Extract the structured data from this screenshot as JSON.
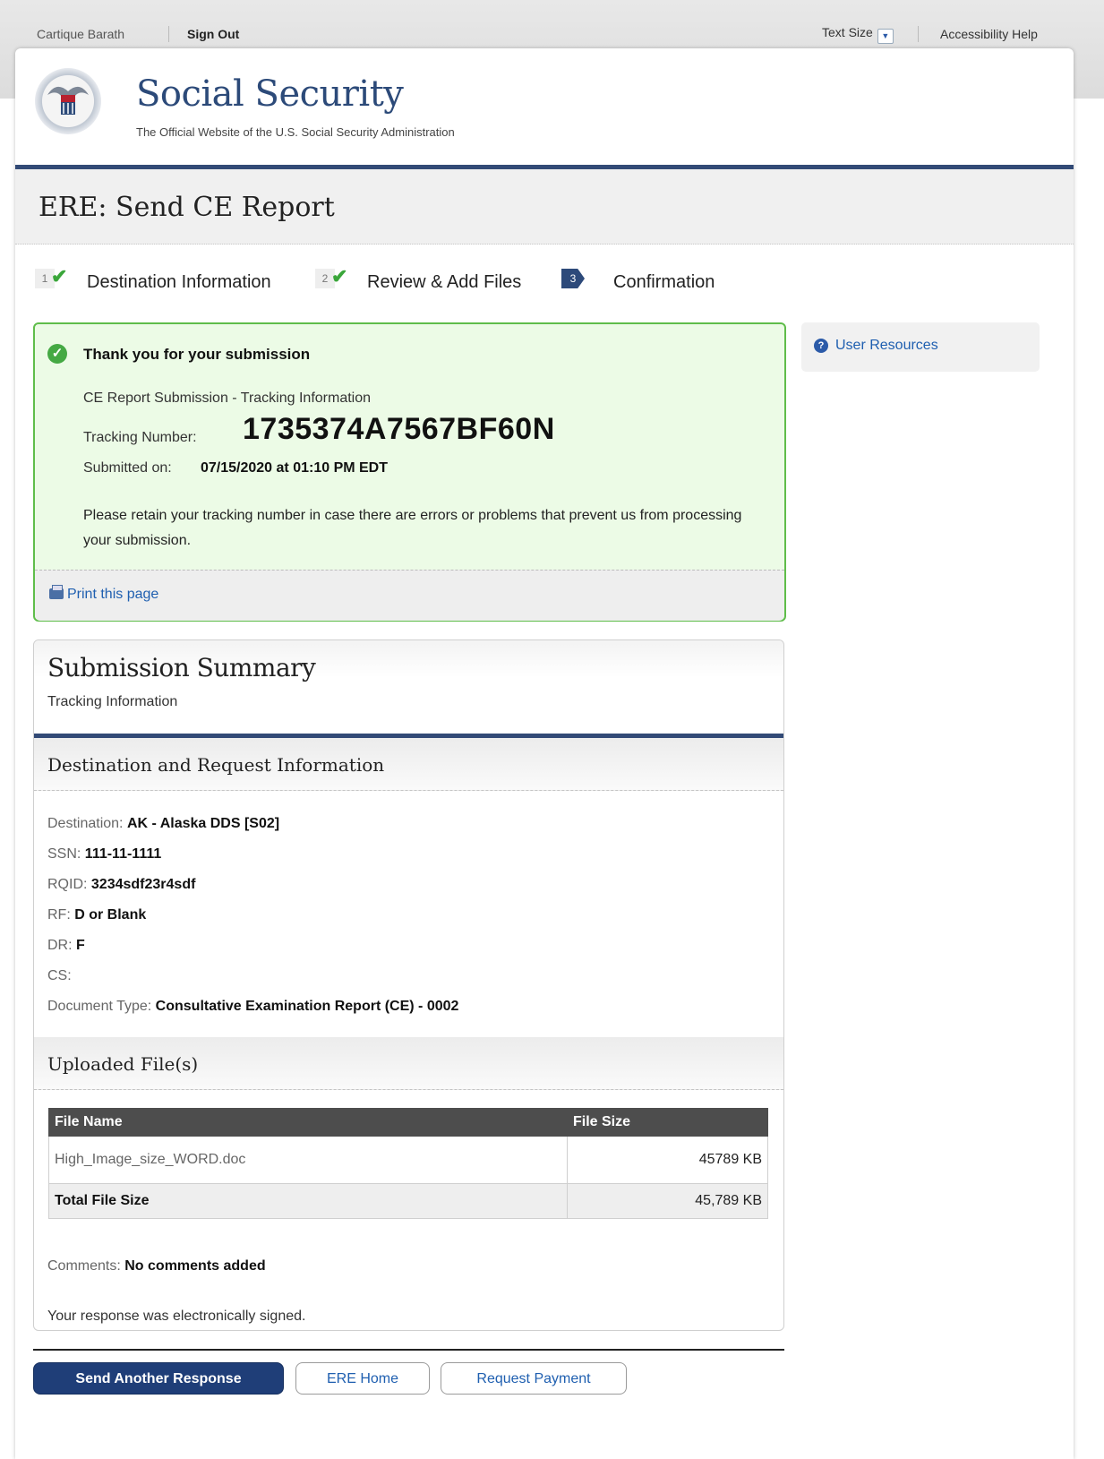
{
  "utility": {
    "user_name": "Cartique Barath",
    "sign_out": "Sign Out",
    "text_size": "Text Size",
    "accessibility_help": "Accessibility Help"
  },
  "header": {
    "title": "Social Security",
    "subtitle": "The Official Website of the U.S. Social Security Administration"
  },
  "page_title": "ERE: Send CE Report",
  "steps": [
    {
      "number": "1",
      "label": "Destination Information",
      "state": "complete"
    },
    {
      "number": "2",
      "label": "Review & Add Files",
      "state": "complete"
    },
    {
      "number": "3",
      "label": "Confirmation",
      "state": "current"
    }
  ],
  "success": {
    "heading": "Thank you for your submission",
    "line1": "CE Report Submission - Tracking Information",
    "tracking_label": "Tracking Number:",
    "tracking_number": "1735374A7567BF60N",
    "submitted_label": "Submitted on:",
    "submitted_value": "07/15/2020 at 01:10 PM EDT",
    "note": "Please retain your tracking number in case there are errors or problems that prevent us from processing your submission.",
    "print_link": "Print this page"
  },
  "sidebar": {
    "user_resources": "User Resources"
  },
  "summary": {
    "title": "Submission Summary",
    "subtitle": "Tracking Information",
    "destination_section": "Destination and Request Information",
    "fields": {
      "destination_label": "Destination:",
      "destination_value": "AK - Alaska DDS [S02]",
      "ssn_label": "SSN:",
      "ssn_value": "111-11-1111",
      "rqid_label": "RQID:",
      "rqid_value": "3234sdf23r4sdf",
      "rf_label": "RF:",
      "rf_value": "D or Blank",
      "dr_label": "DR:",
      "dr_value": "F",
      "cs_label": "CS:",
      "cs_value": "",
      "doctype_label": "Document Type:",
      "doctype_value": "Consultative Examination Report (CE) - 0002"
    },
    "files_section": "Uploaded File(s)",
    "files_table": {
      "headers": [
        "File Name",
        "File Size"
      ],
      "rows": [
        {
          "name": "High_Image_size_WORD.doc",
          "size": "45789 KB"
        }
      ],
      "total_label": "Total File Size",
      "total_value": "45,789 KB"
    },
    "comments_label": "Comments:",
    "comments_value": "No comments added",
    "signed_text": "Your response was electronically signed."
  },
  "buttons": {
    "send_another": "Send Another Response",
    "ere_home": "ERE Home",
    "request_payment": "Request Payment"
  },
  "colors": {
    "navy": "#324a76",
    "success_border": "#5fbd4a",
    "success_bg": "#ecfbe6",
    "link": "#1f5fb0",
    "primary_button": "#1f3e78"
  }
}
